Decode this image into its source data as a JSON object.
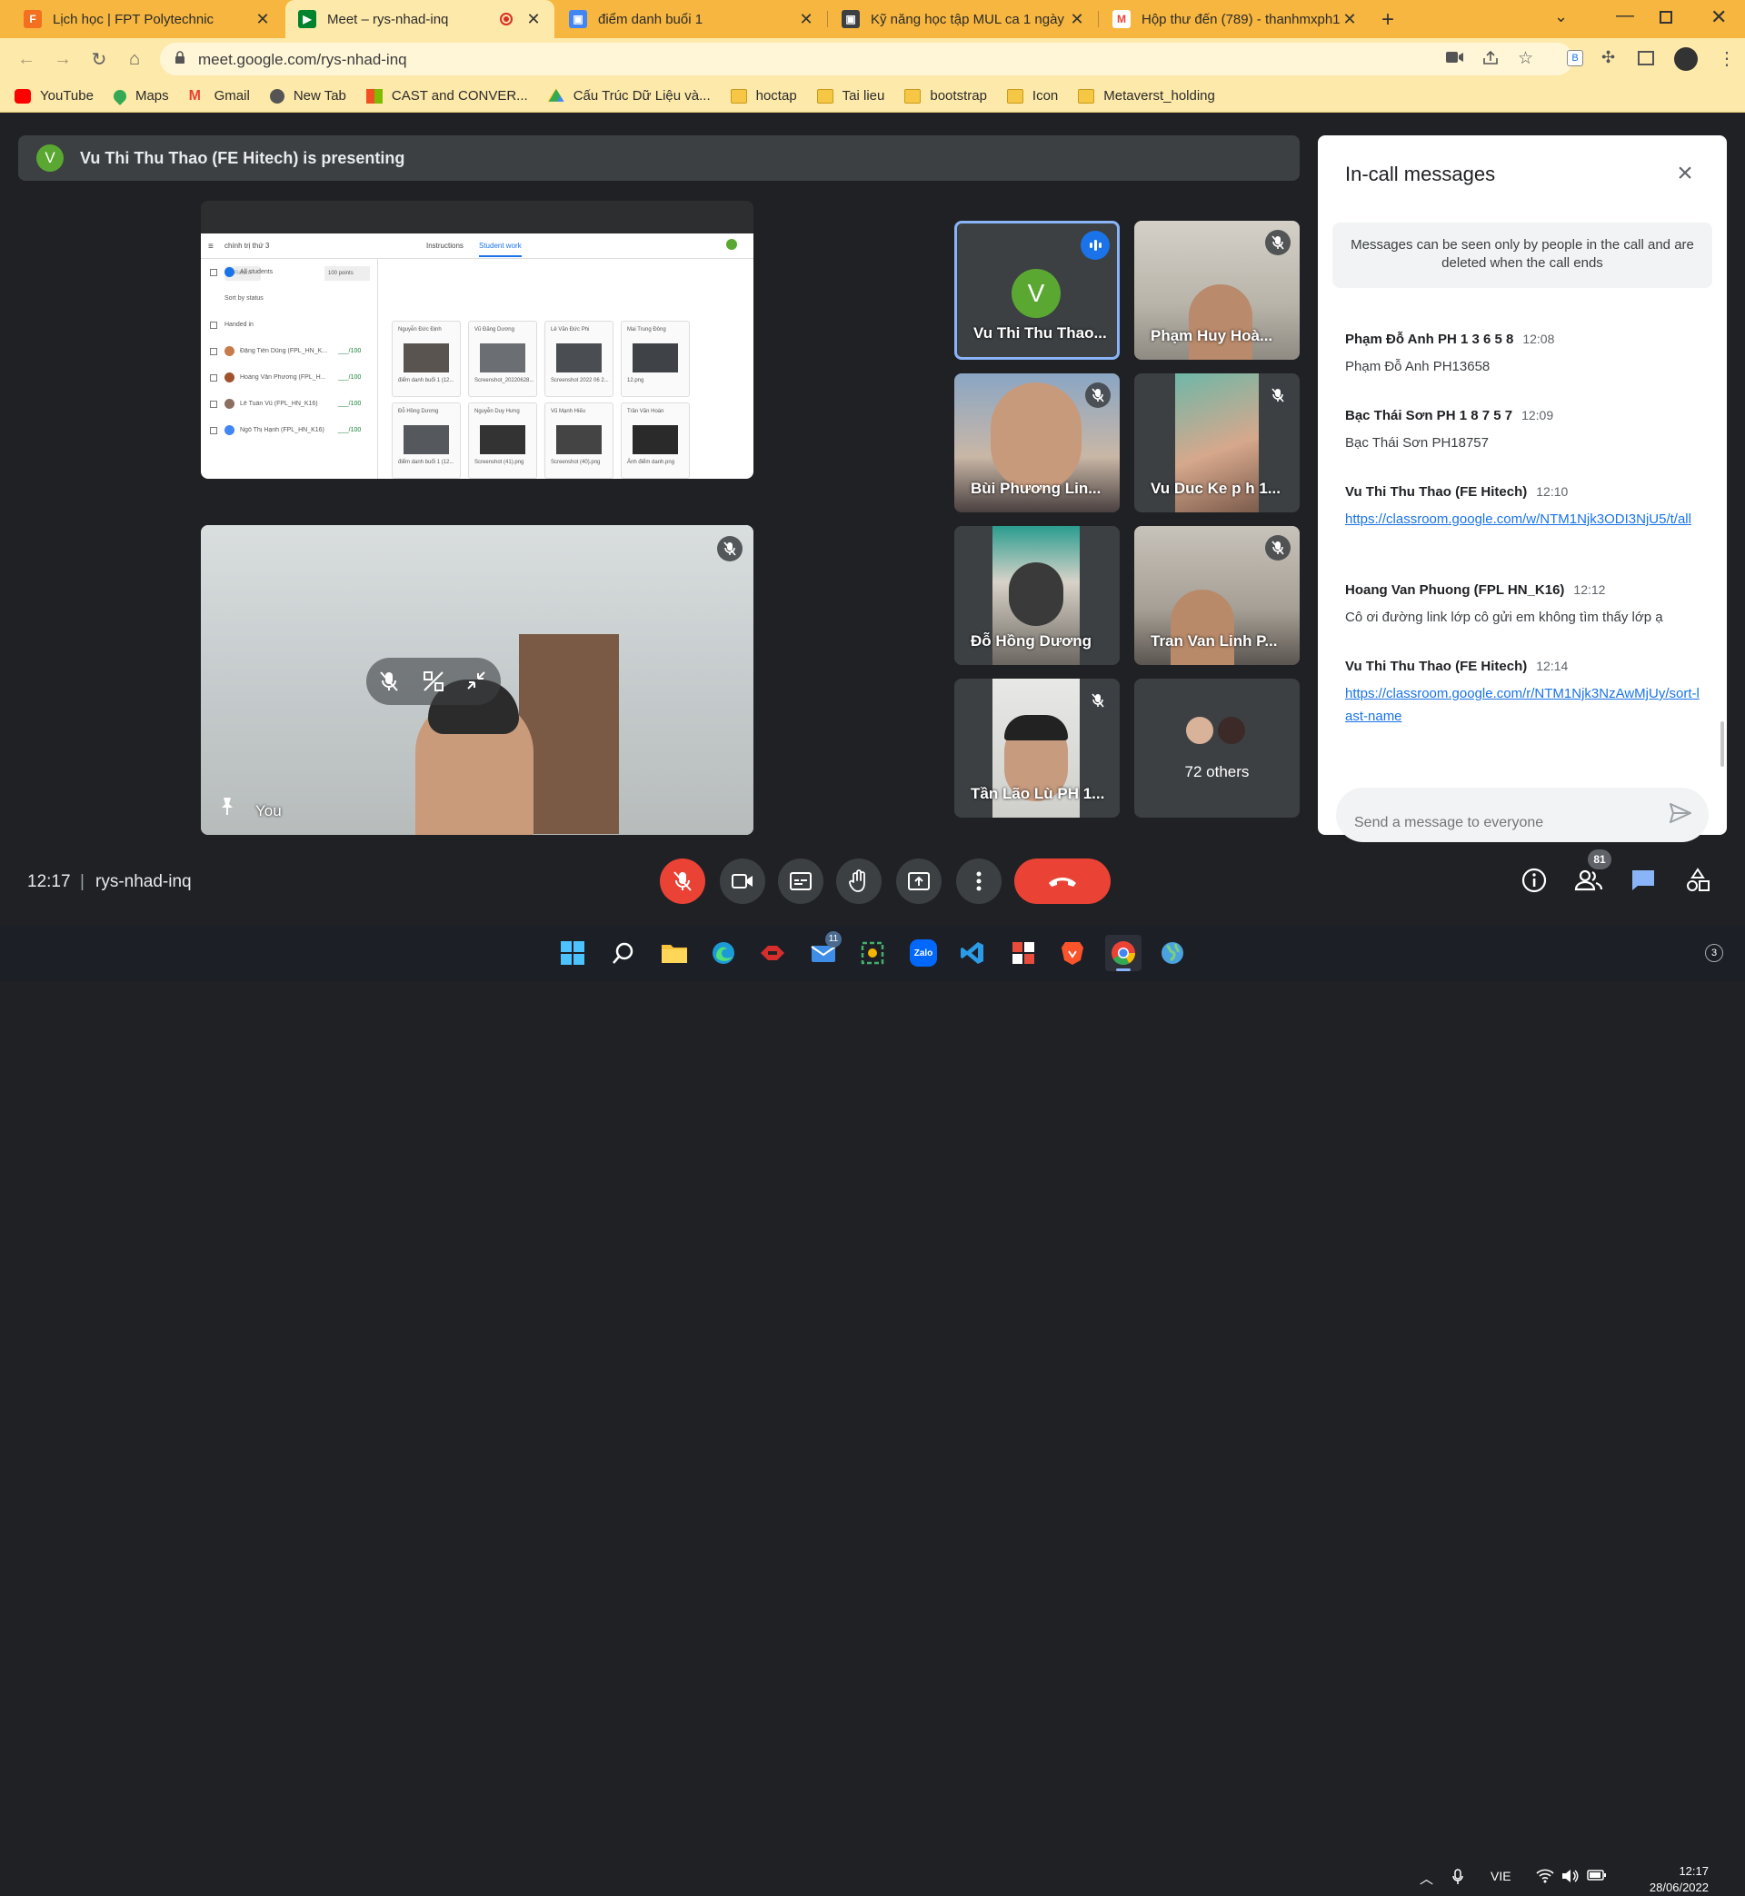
{
  "tabs": [
    {
      "title": "Lịch học | FPT Polytechnic",
      "icon": "fpt-favicon"
    },
    {
      "title": "Meet – rys-nhad-inq",
      "icon": "meet-favicon"
    },
    {
      "title": "điểm danh buổi 1",
      "icon": "classroom-favicon"
    },
    {
      "title": "Kỹ năng học tập MUL ca 1 ngày",
      "icon": "classroom-favicon"
    },
    {
      "title": "Hộp thư đến (789) - thanhmxph1",
      "icon": "gmail-favicon"
    }
  ],
  "address": {
    "url": "meet.google.com/rys-nhad-inq"
  },
  "bookmarks": [
    {
      "label": "YouTube",
      "icon": "youtube-icon"
    },
    {
      "label": "Maps",
      "icon": "maps-icon"
    },
    {
      "label": "Gmail",
      "icon": "gmail-icon"
    },
    {
      "label": "New Tab",
      "icon": "globe-icon"
    },
    {
      "label": "CAST and CONVER...",
      "icon": "windows-icon"
    },
    {
      "label": "Cấu Trúc Dữ Liệu và...",
      "icon": "drive-icon"
    },
    {
      "label": "hoctap",
      "icon": "folder-icon"
    },
    {
      "label": "Tai lieu",
      "icon": "folder-icon"
    },
    {
      "label": "bootstrap",
      "icon": "folder-icon"
    },
    {
      "label": "Icon",
      "icon": "folder-icon"
    },
    {
      "label": "Metaverst_holding",
      "icon": "folder-icon"
    }
  ],
  "presenting": {
    "avatar_letter": "V",
    "text": "Vu Thi Thu Thao (FE Hitech) is presenting"
  },
  "shared_screen": {
    "title": "chính trị thứ 3",
    "tabs": [
      "Instructions",
      "Student work"
    ],
    "points": "100 points",
    "return_label": "Return",
    "all_students": "All students",
    "sort": "Sort by status",
    "section": "Handed in",
    "students": [
      {
        "name": "Đặng Tiến Dũng (FPL_HN_K...",
        "grade": "___/100"
      },
      {
        "name": "Hoàng Văn Phương (FPL_H...",
        "grade": "___/100"
      },
      {
        "name": "Lê Tuấn Vũ (FPL_HN_K16)",
        "grade": "___/100"
      },
      {
        "name": "Ngô Thị Hạnh (FPL_HN_K16)",
        "grade": "___/100"
      }
    ],
    "cards": [
      {
        "name": "Nguyễn Đức Định",
        "file": "điểm danh buổi 1 (12..."
      },
      {
        "name": "Vũ Đăng Dương",
        "file": "Screenshot_20220628..."
      },
      {
        "name": "Lê Văn Đức Phi",
        "file": "Screenshot 2022 06 2..."
      },
      {
        "name": "Mai Trung Đông",
        "file": "12.png"
      },
      {
        "name": "Đỗ Hồng Dương",
        "file": "điểm danh buổi 1 (12..."
      },
      {
        "name": "Nguyễn Duy Hưng",
        "file": "Screenshot (41).png"
      },
      {
        "name": "Vũ Mạnh Hiếu",
        "file": "Screenshot (40).png"
      },
      {
        "name": "Trần Văn Hoàn",
        "file": "Ảnh điểm danh.png"
      }
    ]
  },
  "self_view": {
    "name": "You"
  },
  "participants": [
    {
      "name": "Vu Thi Thu Thao...",
      "avatar_letter": "V",
      "speaking": true
    },
    {
      "name": "Phạm Huy Hoà...",
      "muted": true
    },
    {
      "name": "Bùi Phương Lin...",
      "muted": true
    },
    {
      "name": "Vu Duc Ke p h 1...",
      "muted": true
    },
    {
      "name": "Đỗ Hồng Dương",
      "muted": false
    },
    {
      "name": "Tran Van Linh P...",
      "muted": true
    },
    {
      "name": "Tần Lão Lù PH 1...",
      "muted": true
    }
  ],
  "others": {
    "label": "72 others"
  },
  "chat": {
    "title": "In-call messages",
    "notice": "Messages can be seen only by people in the call and are deleted when the call ends",
    "messages": [
      {
        "sender": "Phạm Đỗ Anh PH 1 3 6 5 8",
        "time": "12:08",
        "text": "Phạm Đỗ Anh PH13658"
      },
      {
        "sender": "Bạc Thái Sơn PH 1 8 7 5 7",
        "time": "12:09",
        "text": "Bạc Thái Sơn PH18757"
      },
      {
        "sender": "Vu Thi Thu Thao (FE Hitech)",
        "time": "12:10",
        "text": "https://classroom.google.com/w/NTM1Njk3ODI3NjU5/t/all"
      },
      {
        "sender": "Hoang Van Phuong (FPL HN_K16)",
        "time": "12:12",
        "text": "Cô ơi đường link lớp cô gửi em không tìm thấy lớp ạ"
      },
      {
        "sender": "Vu Thi Thu Thao (FE Hitech)",
        "time": "12:14",
        "text": "https://classroom.google.com/r/NTM1Njk3NzAwMjUy/sort-last-name"
      }
    ],
    "input_placeholder": "Send a message to everyone"
  },
  "meeting": {
    "time": "12:17",
    "separator": "|",
    "code": "rys-nhad-inq",
    "people_count": "81"
  },
  "taskbar": {
    "apps": [
      "start-icon",
      "search-icon",
      "file-explorer-icon",
      "edge-icon",
      "game-icon",
      "mail-icon",
      "snip-icon",
      "zalo-icon",
      "vscode-icon",
      "office-icon",
      "brave-icon",
      "chrome-icon",
      "globe-icon"
    ],
    "mail_badge": "11",
    "zalo_label": "Zalo",
    "language": "VIE",
    "time": "12:17",
    "date": "28/06/2022",
    "notif_count": "3"
  },
  "colors": {
    "tabstrip": "#f6b63f",
    "toolbar": "#fde9a9",
    "meet_bg": "#202124",
    "leave": "#ea4335",
    "link": "#1a73e8"
  }
}
